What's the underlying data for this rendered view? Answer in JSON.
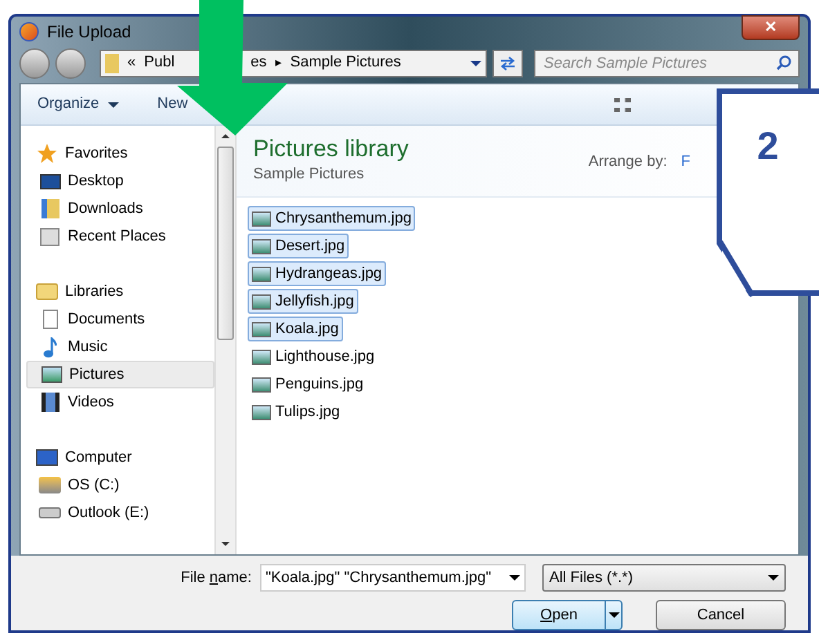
{
  "window": {
    "title": "File Upload",
    "close": "✕"
  },
  "address": {
    "prefix": "«",
    "parts": [
      "Publ",
      "es"
    ],
    "separator": "▸",
    "current": "Sample Pictures"
  },
  "search": {
    "placeholder": "Search Sample Pictures"
  },
  "toolbar": {
    "organize": "Organize",
    "new": "New"
  },
  "sidebar": {
    "groups": [
      {
        "label": "Favorites",
        "kind": "favorites",
        "children": [
          {
            "label": "Desktop",
            "kind": "desktop",
            "selected": false
          },
          {
            "label": "Downloads",
            "kind": "downloads",
            "selected": false
          },
          {
            "label": "Recent Places",
            "kind": "recent",
            "selected": false
          }
        ]
      },
      {
        "label": "Libraries",
        "kind": "libraries",
        "children": [
          {
            "label": "Documents",
            "kind": "documents",
            "selected": false
          },
          {
            "label": "Music",
            "kind": "music",
            "selected": false
          },
          {
            "label": "Pictures",
            "kind": "pictures",
            "selected": true
          },
          {
            "label": "Videos",
            "kind": "videos",
            "selected": false
          }
        ]
      },
      {
        "label": "Computer",
        "kind": "computer",
        "children": [
          {
            "label": "OS (C:)",
            "kind": "drive",
            "selected": false
          },
          {
            "label": "Outlook (E:)",
            "kind": "removable",
            "selected": false
          }
        ]
      }
    ]
  },
  "library": {
    "title": "Pictures library",
    "subtitle": "Sample Pictures",
    "arrange_label": "Arrange by:",
    "arrange_value": "F"
  },
  "files": [
    {
      "name": "Chrysanthemum.jpg",
      "selected": true
    },
    {
      "name": "Desert.jpg",
      "selected": true
    },
    {
      "name": "Hydrangeas.jpg",
      "selected": true
    },
    {
      "name": "Jellyfish.jpg",
      "selected": true
    },
    {
      "name": "Koala.jpg",
      "selected": true
    },
    {
      "name": "Lighthouse.jpg",
      "selected": false
    },
    {
      "name": "Penguins.jpg",
      "selected": false
    },
    {
      "name": "Tulips.jpg",
      "selected": false
    }
  ],
  "filename": {
    "label_before": "File ",
    "label_key": "n",
    "label_after": "ame:",
    "value": "\"Koala.jpg\" \"Chrysanthemum.jpg\""
  },
  "filetype": {
    "value": "All Files (*.*)"
  },
  "buttons": {
    "open_key": "O",
    "open_rest": "pen",
    "cancel": "Cancel"
  },
  "callout": {
    "number": "2"
  }
}
